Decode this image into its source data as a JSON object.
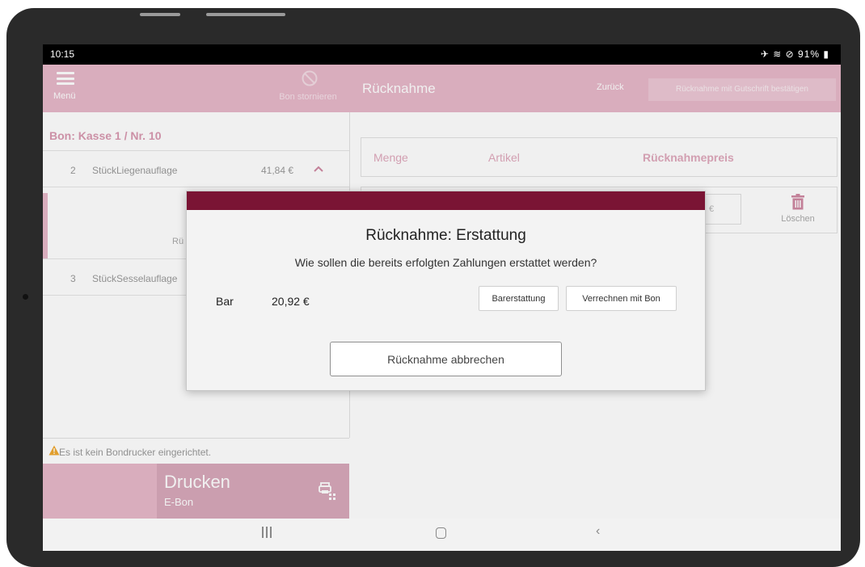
{
  "status_bar": {
    "time": "10:15",
    "icons_text": "✈ ≋ ⊘",
    "battery": "91%"
  },
  "left_header": {
    "menu_label": "Menü",
    "storno_label": "Bon stornieren"
  },
  "right_header": {
    "title": "Rücknahme",
    "back_label": "Zurück",
    "confirm_label": "Rücknahme mit Gutschrift bestätigen"
  },
  "bon": {
    "title": "Bon: Kasse 1 / Nr. 10",
    "items": [
      {
        "qty": "2",
        "name": "StückLiegenauflage",
        "price": "41,84 €"
      },
      {
        "qty": "3",
        "name": "StückSesselauflage"
      }
    ],
    "expanded_text": "Rü"
  },
  "warning": {
    "text": "Es ist kein Bondrucker eingerichtet."
  },
  "print": {
    "title": "Drucken",
    "subtitle": "E-Bon"
  },
  "return_table": {
    "headers": {
      "qty": "Menge",
      "article": "Artikel",
      "price": "Rücknahmepreis"
    },
    "row": {
      "price_suffix": "€",
      "delete_label": "Löschen"
    }
  },
  "modal": {
    "title": "Rücknahme: Erstattung",
    "question": "Wie sollen die bereits erfolgten Zahlungen erstattet werden?",
    "payment": {
      "method": "Bar",
      "amount": "20,92 €"
    },
    "cash_refund_label": "Barerstattung",
    "offset_label": "Verrechnen mit Bon",
    "cancel_label": "Rücknahme abbrechen"
  },
  "colors": {
    "accent": "#e7b8c9",
    "modal_bar": "#7a1434",
    "warning": "#f0a830"
  },
  "nav": {
    "back_glyph": "‹"
  }
}
